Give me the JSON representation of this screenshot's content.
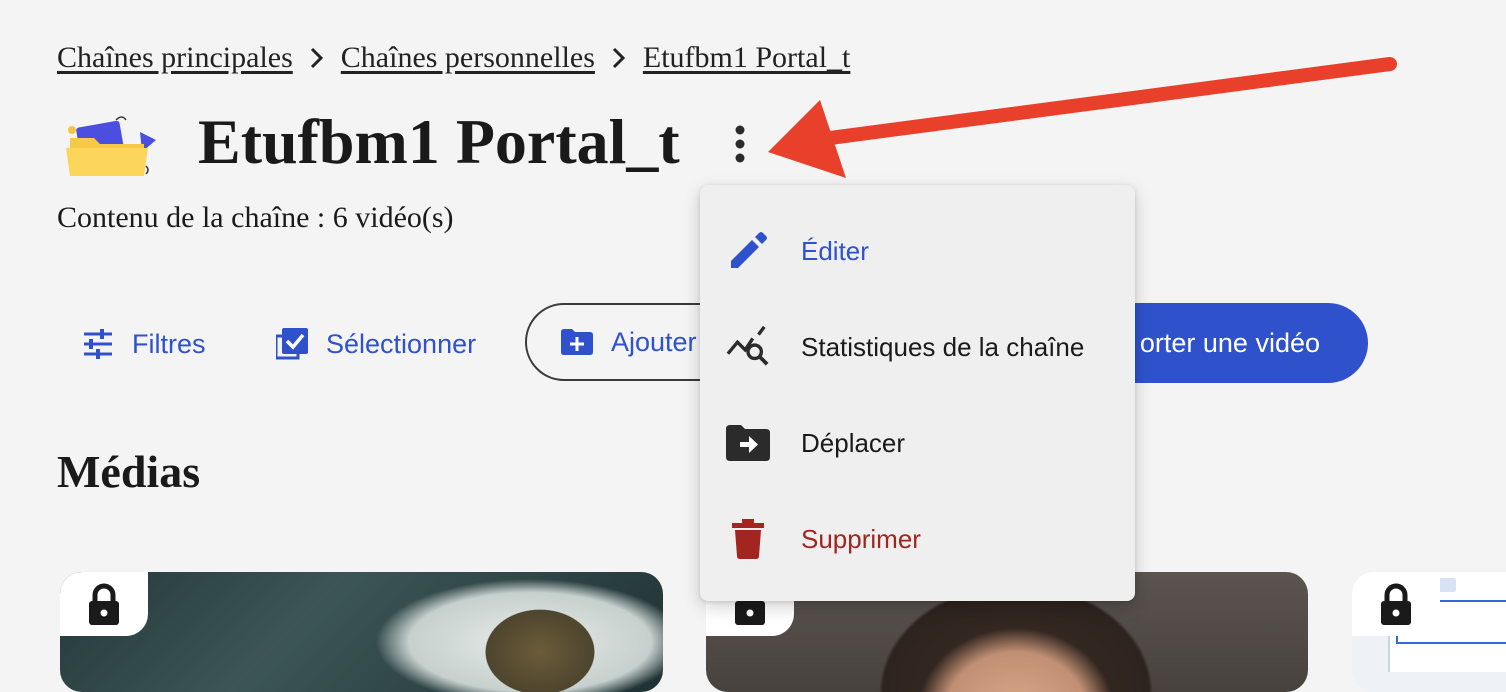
{
  "breadcrumb": {
    "items": [
      "Chaînes principales",
      "Chaînes personnelles",
      "Etufbm1 Portal_t"
    ],
    "separator_icon": "chevron-right-icon"
  },
  "header": {
    "title": "Etufbm1 Portal_t",
    "subtitle": "Contenu de la chaîne : 6 vidéo(s)",
    "channel_icon": "folder-video-icon",
    "more_icon": "more-vertical-icon"
  },
  "toolbar": {
    "filters_label": "Filtres",
    "select_label": "Sélectionner",
    "add_label": "Ajouter",
    "upload_label": "orter une vidéo"
  },
  "section": {
    "title": "Médias"
  },
  "menu": {
    "items": [
      {
        "label": "Éditer",
        "icon": "pencil-icon",
        "color": "#2f52cc"
      },
      {
        "label": "Statistiques de la chaîne",
        "icon": "chart-search-icon",
        "color": "#1a1a1a"
      },
      {
        "label": "Déplacer",
        "icon": "folder-move-icon",
        "color": "#1a1a1a"
      },
      {
        "label": "Supprimer",
        "icon": "trash-icon",
        "color": "#a3251f"
      }
    ]
  },
  "media_cards": [
    {
      "locked": true,
      "icon": "lock-icon"
    },
    {
      "locked": true,
      "icon": "lock-icon"
    },
    {
      "locked": true,
      "icon": "lock-icon"
    }
  ],
  "colors": {
    "accent": "#2f52cc",
    "danger": "#a3251f",
    "annotation_arrow": "#e8402a",
    "background": "#f4f4f4"
  }
}
